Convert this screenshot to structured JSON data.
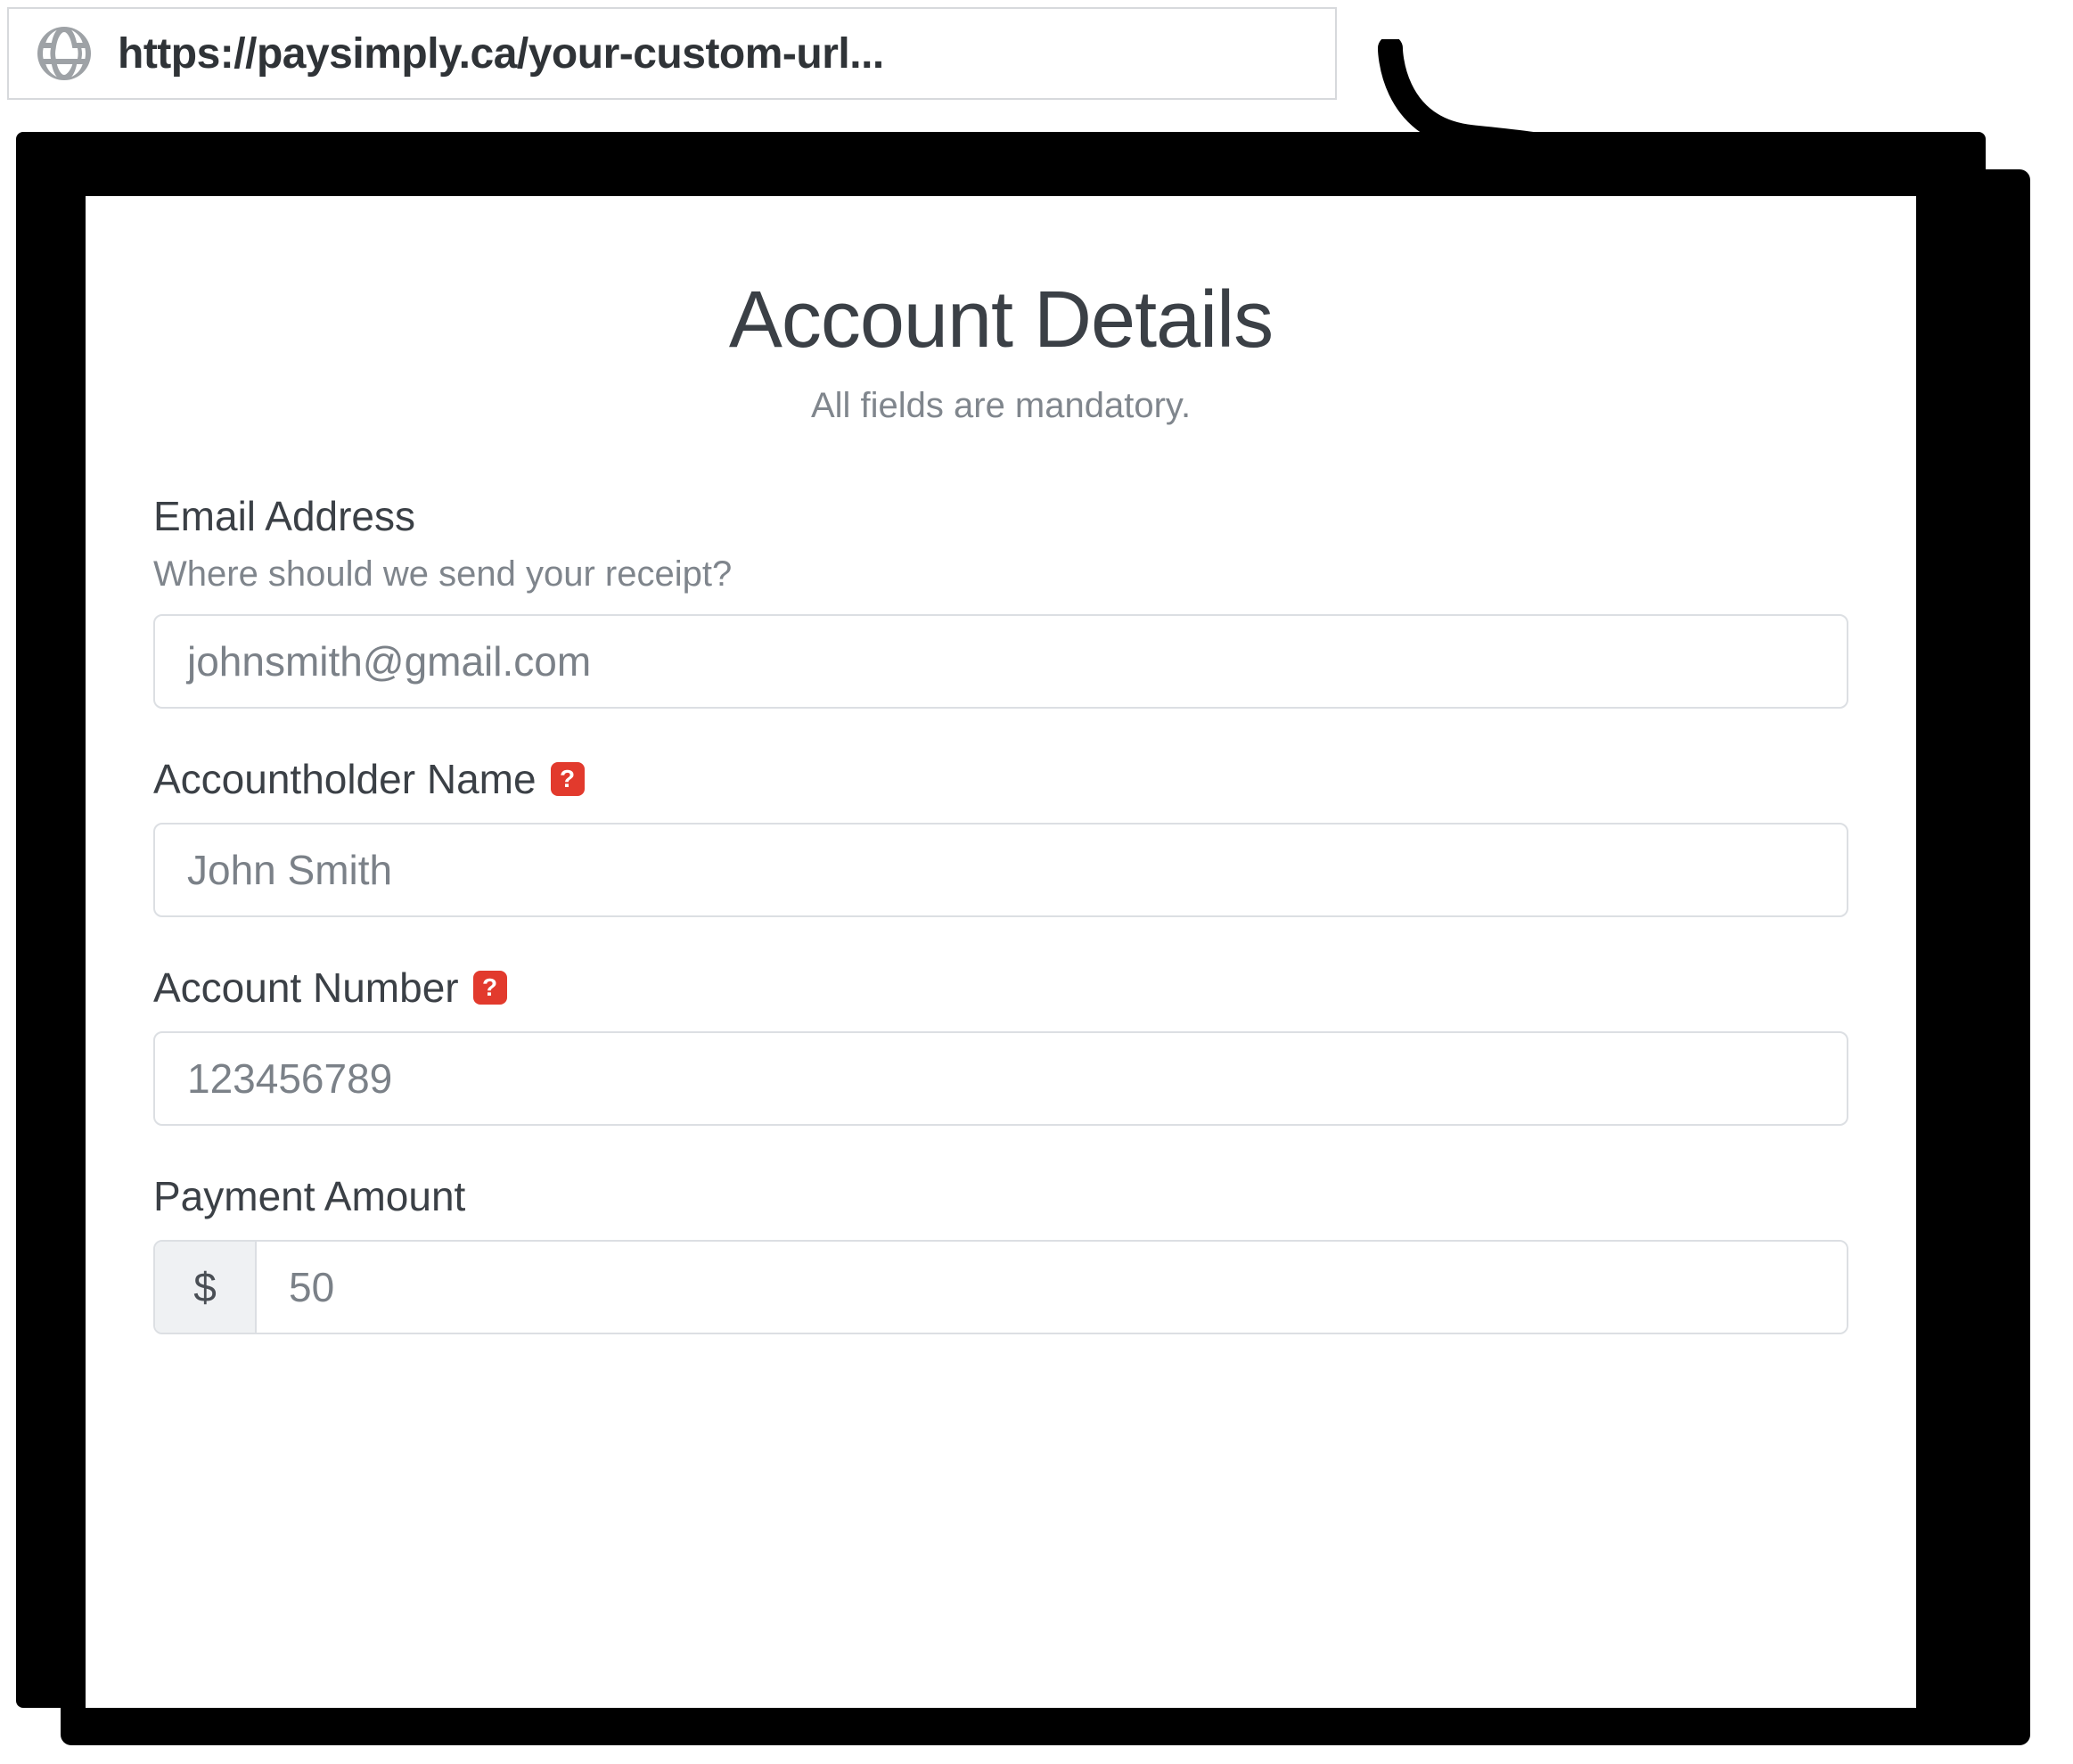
{
  "url_bar": {
    "url": "https://paysimply.ca/your-custom-url..."
  },
  "page": {
    "title": "Account Details",
    "subtitle": "All fields are mandatory."
  },
  "form": {
    "email": {
      "label": "Email Address",
      "help": "Where should we send your receipt?",
      "value": "johnsmith@gmail.com"
    },
    "accountholder": {
      "label": "Accountholder Name",
      "value": "John Smith",
      "help_badge": "?"
    },
    "account_number": {
      "label": "Account Number",
      "value": "123456789",
      "help_badge": "?"
    },
    "amount": {
      "label": "Payment Amount",
      "currency_symbol": "$",
      "value": "50"
    }
  }
}
